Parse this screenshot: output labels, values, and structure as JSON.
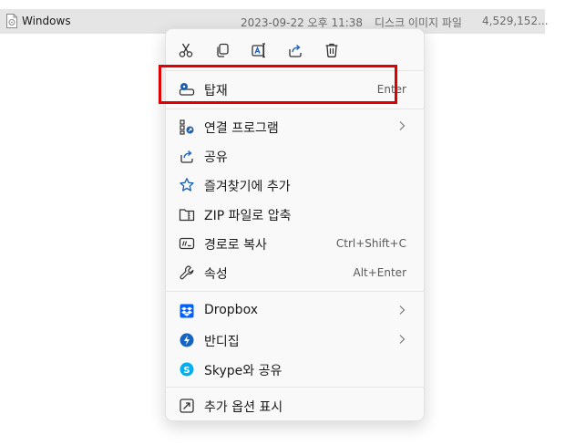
{
  "file_row": {
    "name": "Windows",
    "date": "2023-09-22 오후 11:38",
    "type": "디스크 이미지 파일",
    "size": "4,529,152..."
  },
  "toolbar": {
    "buttons": [
      {
        "icon": "cut-icon"
      },
      {
        "icon": "copy-icon"
      },
      {
        "icon": "rename-icon"
      },
      {
        "icon": "share-icon"
      },
      {
        "icon": "delete-icon"
      }
    ]
  },
  "menu": {
    "mount": {
      "label": "탑재",
      "shortcut": "Enter",
      "icon": "mount-icon"
    },
    "open_with": {
      "label": "연결 프로그램",
      "icon": "open-with-icon"
    },
    "share": {
      "label": "공유",
      "icon": "share-icon"
    },
    "favorites": {
      "label": "즐겨찾기에 추가",
      "icon": "star-icon"
    },
    "zip": {
      "label": "ZIP 파일로 압축",
      "icon": "zip-icon"
    },
    "copy_path": {
      "label": "경로로 복사",
      "shortcut": "Ctrl+Shift+C",
      "icon": "path-icon"
    },
    "properties": {
      "label": "속성",
      "shortcut": "Alt+Enter",
      "icon": "wrench-icon"
    },
    "dropbox": {
      "label": "Dropbox",
      "icon": "dropbox-icon",
      "color": "#0061fe"
    },
    "bandizip": {
      "label": "반디집",
      "icon": "bandizip-icon",
      "color": "#1565c0"
    },
    "skype": {
      "label": "Skype와 공유",
      "icon": "skype-icon",
      "color": "#00aff0"
    },
    "more": {
      "label": "추가 옵션 표시",
      "icon": "more-options-icon"
    }
  },
  "colors": {
    "highlight_box": "#e00000",
    "icon_blue": "#1a5fb4"
  }
}
